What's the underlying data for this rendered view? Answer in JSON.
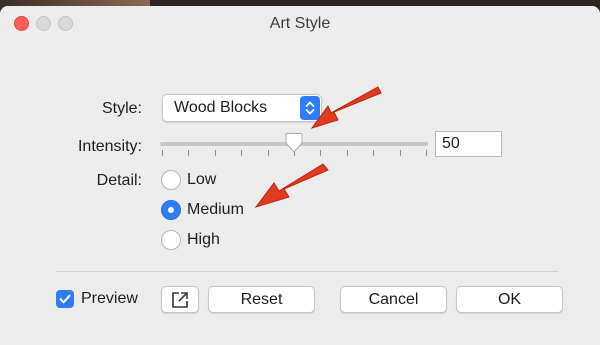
{
  "window": {
    "title": "Art Style"
  },
  "style_row": {
    "label": "Style:",
    "selected": "Wood Blocks"
  },
  "intensity_row": {
    "label": "Intensity:",
    "value": "50",
    "slider_fraction": 0.5
  },
  "detail_row": {
    "label": "Detail:",
    "options": [
      "Low",
      "Medium",
      "High"
    ],
    "selected": "Medium"
  },
  "footer": {
    "preview_label": "Preview",
    "preview_checked": true,
    "reset_label": "Reset",
    "cancel_label": "Cancel",
    "ok_label": "OK"
  },
  "icons": {
    "open_external": "open-external-icon",
    "arrow_annotation": "red-arrow"
  },
  "colors": {
    "accent": "#2f7df6",
    "annotation_arrow": "#e23a1f"
  }
}
